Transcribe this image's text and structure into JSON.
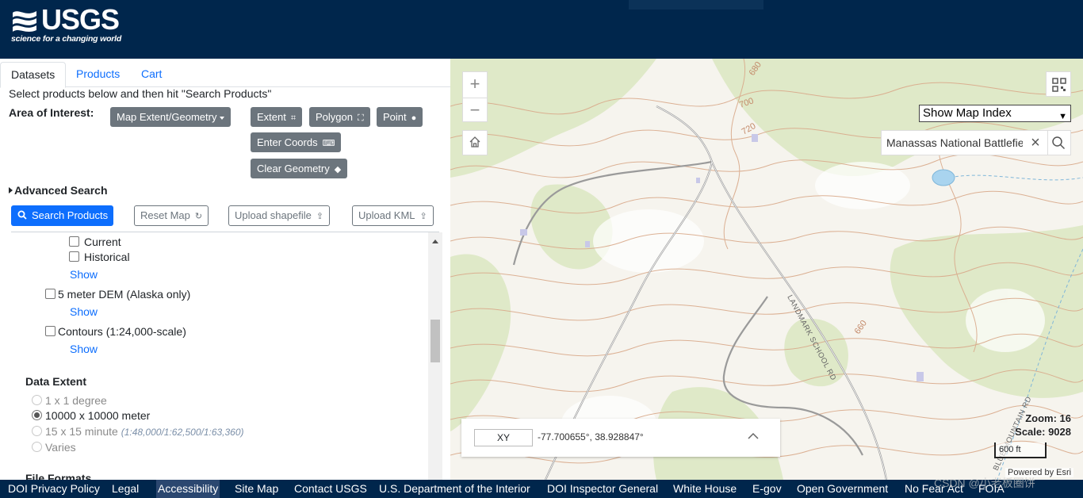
{
  "header": {
    "logo_text": "USGS",
    "logo_tagline": "science for a changing world"
  },
  "tabs": [
    {
      "label": "Datasets",
      "active": true
    },
    {
      "label": "Products",
      "active": false
    },
    {
      "label": "Cart",
      "active": false
    }
  ],
  "instruction": "Select products below and then hit \"Search Products\"",
  "area_of_interest": {
    "label": "Area of Interest:",
    "map_extent_button": "Map Extent/Geometry",
    "extent_button": "Extent",
    "polygon_button": "Polygon",
    "point_button": "Point",
    "enter_coords_button": "Enter Coords",
    "clear_geometry_button": "Clear Geometry"
  },
  "advanced_search": "Advanced Search",
  "actions": {
    "search_products": "Search Products",
    "reset_map": "Reset Map",
    "upload_shapefile": "Upload shapefile",
    "upload_kml": "Upload KML"
  },
  "datasets": {
    "current_label": "Current",
    "historical_label": "Historical",
    "show_1": "Show",
    "dem_label": "5 meter DEM (Alaska only)",
    "show_2": "Show",
    "contours_label": "Contours (1:24,000-scale)",
    "show_3": "Show"
  },
  "data_extent": {
    "title": "Data Extent",
    "options": [
      {
        "label": "1 x 1 degree",
        "checked": false,
        "disabled": true
      },
      {
        "label": "10000 x 10000 meter",
        "checked": true,
        "disabled": false
      },
      {
        "label": "15 x 15 minute",
        "note": "(1:48,000/1:62,500/1:63,360)",
        "checked": false,
        "disabled": true
      },
      {
        "label": "Varies",
        "checked": false,
        "disabled": true
      }
    ]
  },
  "file_formats_title": "File Formats",
  "map": {
    "index_select": "Show Map Index",
    "search_value": "Manassas National Battlefield",
    "coord_mode": "XY",
    "coordinates": "-77.700655°, 38.928847°",
    "zoom_text": "Zoom: 16",
    "scale_text": "Scale: 9028",
    "scalebar_label": "600 ft",
    "attribution": "Powered by Esri",
    "road_label_1": "LANDMARK SCHOOL RD",
    "road_label_2": "BLUE MOUNTAIN RD",
    "contour_labels": [
      "680",
      "700",
      "720",
      "660"
    ]
  },
  "footer": {
    "links": [
      "DOI Privacy Policy",
      "Legal",
      "Accessibility",
      "Site Map",
      "Contact USGS",
      "U.S. Department of the Interior",
      "DOI Inspector General",
      "White House",
      "E-gov",
      "Open Government",
      "No Fear Act",
      "FOIA"
    ]
  },
  "watermark": "CSDN @小老板圈饼",
  "colors": {
    "header_bg": "#00264c",
    "primary": "#0d6efd",
    "gray_button": "#6c757d"
  }
}
